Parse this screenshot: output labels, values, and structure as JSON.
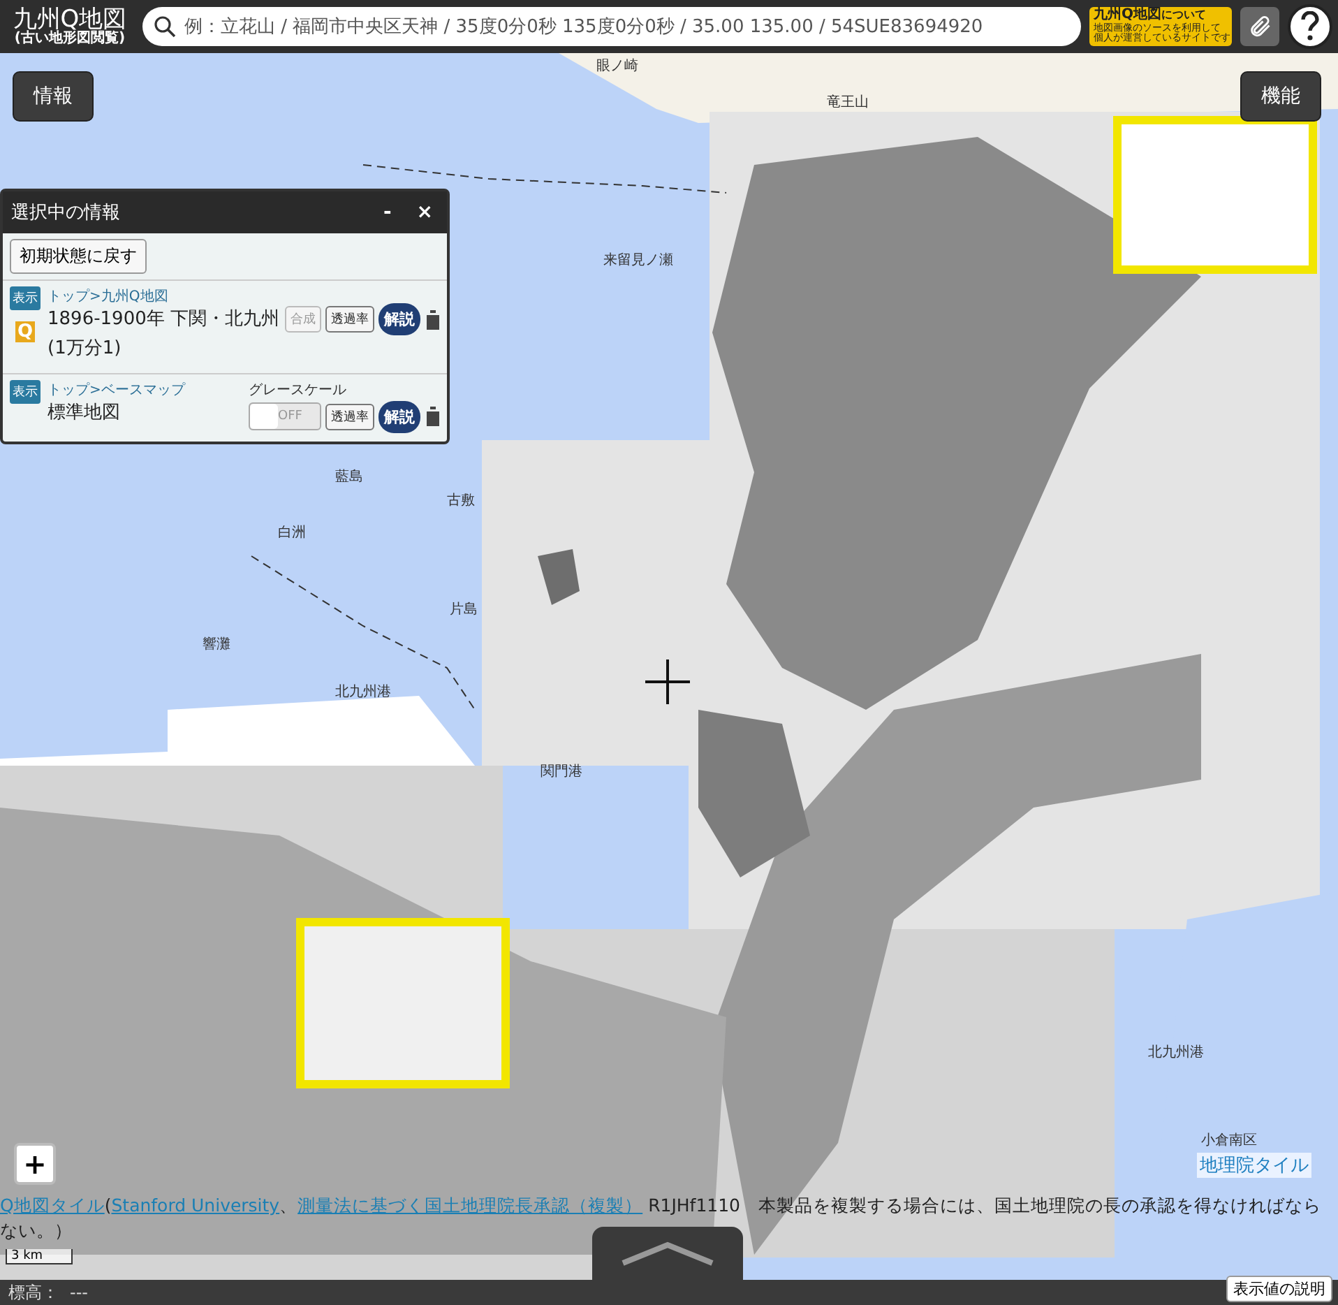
{
  "header": {
    "logo_title": "九州Q地図",
    "logo_subtitle": "(古い地形図閲覧)",
    "search": {
      "placeholder": "例：立花山 / 福岡市中央区天神 / 35度0分0秒 135度0分0秒 / 35.00 135.00 / 54SUE83694920"
    },
    "about_banner": {
      "title": "九州Q地図",
      "suffix": "について",
      "lines": [
        "地図画像のソースを利用して",
        "個人が運営しているサイトです"
      ]
    }
  },
  "info_button": "情報",
  "function_button": "機能",
  "panel": {
    "title": "選択中の情報",
    "minimize": "-",
    "close": "×",
    "reset_button": "初期状態に戻す",
    "layers": [
      {
        "badge": "表示",
        "path": "トップ>九州Q地図",
        "name": "1896-1900年 下関・北九州(1万分1)",
        "q_mark": "Q",
        "compose": "合成",
        "opacity": "透過率",
        "explain": "解説"
      },
      {
        "badge": "表示",
        "path": "トップ>ベースマップ",
        "name": "標準地図",
        "grayscale": {
          "label": "グレースケール",
          "state": "OFF",
          "on": false
        },
        "opacity": "透過率",
        "explain": "解説"
      }
    ]
  },
  "map_labels": [
    {
      "text": "眼ノ崎"
    },
    {
      "text": "竜王山"
    },
    {
      "text": "来留見ノ瀬"
    },
    {
      "text": "藍島"
    },
    {
      "text": "古敷"
    },
    {
      "text": "白洲"
    },
    {
      "text": "片島"
    },
    {
      "text": "響灘"
    },
    {
      "text": "北九州港"
    },
    {
      "text": "関門港"
    },
    {
      "text": "北九州港"
    },
    {
      "text": "小倉南区"
    },
    {
      "text": "地理院タイル",
      "kind": "tag"
    }
  ],
  "zoom_in": "+",
  "scale": "3 km",
  "attribution": [
    {
      "text": "Q地図タイル",
      "link": true
    },
    {
      "text": "(",
      "link": false
    },
    {
      "text": "Stanford University",
      "link": true
    },
    {
      "text": "、",
      "link": false
    },
    {
      "text": "測量法に基づく国土地理院長承認（複製）",
      "link": true
    },
    {
      "text": " R1JHf1110　本製品を複製する場合には、国土地理院の長の承認を得なければならない。）",
      "link": false
    }
  ],
  "status_bar": {
    "label": "標高：",
    "value": "---",
    "help_button": "表示値の説明"
  }
}
